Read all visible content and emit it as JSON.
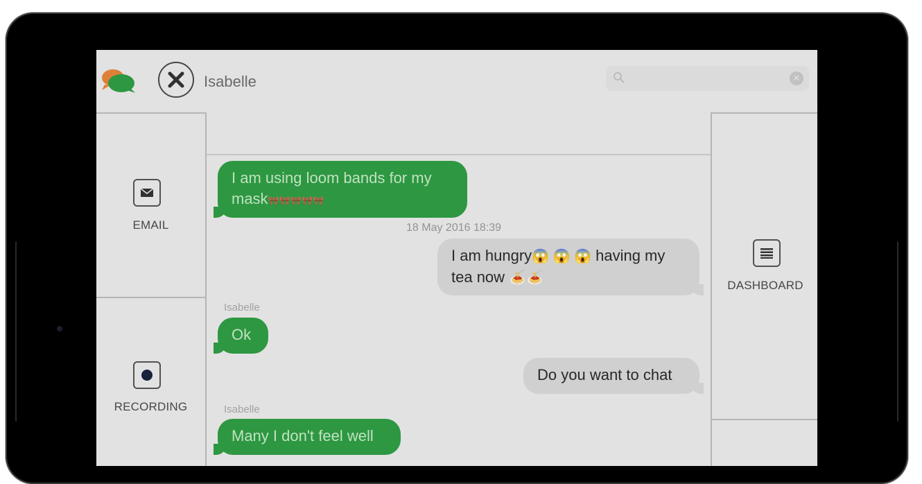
{
  "header": {
    "contact_name": "Isabelle",
    "search_placeholder": ""
  },
  "left_panel": {
    "email_label": "EMAIL",
    "recording_label": "RECORDING"
  },
  "right_panel": {
    "dashboard_label": "DASHBOARD"
  },
  "messages": [
    {
      "direction": "in",
      "sender": "",
      "text_line1": "I am using loom bands for my",
      "text_line2": "mask",
      "emoji": "🎀🎀🎀🎀🎀"
    },
    {
      "type": "timestamp",
      "text": "18 May 2016 18:39"
    },
    {
      "direction": "out",
      "text_line1_a": "I am hungry",
      "emoji_a": "😱 😱 😱",
      "text_line1_b": " having my",
      "text_line2": "tea now ",
      "emoji_b": "🍝🍝"
    },
    {
      "direction": "in",
      "sender": "Isabelle",
      "text": "Ok"
    },
    {
      "direction": "out",
      "text": "Do you want to chat"
    },
    {
      "direction": "in",
      "sender": "Isabelle",
      "text": "Many I don't feel well"
    }
  ],
  "colors": {
    "incoming_bubble": "#2f9e44",
    "outgoing_bubble": "#d9d9d9",
    "frame": "#000000",
    "screen_bg": "#ececec"
  }
}
